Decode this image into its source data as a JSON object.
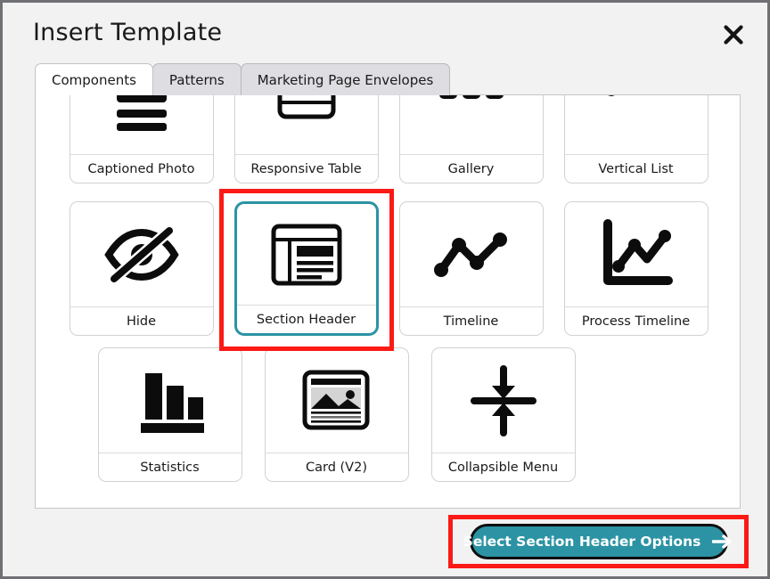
{
  "dialog": {
    "title": "Insert Template",
    "close_icon": "close-icon"
  },
  "tabs": [
    {
      "label": "Components",
      "active": true
    },
    {
      "label": "Patterns",
      "active": false
    },
    {
      "label": "Marketing Page Envelopes",
      "active": false
    }
  ],
  "templates": {
    "rows": [
      [
        {
          "label": "Captioned Photo",
          "icon": "captioned-photo-icon",
          "selected": false
        },
        {
          "label": "Responsive Table",
          "icon": "responsive-table-icon",
          "selected": false
        },
        {
          "label": "Gallery",
          "icon": "gallery-icon",
          "selected": false
        },
        {
          "label": "Vertical List",
          "icon": "vertical-list-icon",
          "selected": false
        }
      ],
      [
        {
          "label": "Hide",
          "icon": "eye-slash-icon",
          "selected": false
        },
        {
          "label": "Section Header",
          "icon": "section-header-icon",
          "selected": true
        },
        {
          "label": "Timeline",
          "icon": "timeline-icon",
          "selected": false
        },
        {
          "label": "Process Timeline",
          "icon": "process-timeline-icon",
          "selected": false
        }
      ],
      [
        {
          "label": "Statistics",
          "icon": "bar-chart-icon",
          "selected": false
        },
        {
          "label": "Card (V2)",
          "icon": "card-image-icon",
          "selected": false
        },
        {
          "label": "Collapsible Menu",
          "icon": "collapse-arrows-icon",
          "selected": false
        }
      ]
    ]
  },
  "footer": {
    "cta_label": "Select Section Header Options",
    "cta_icon": "arrow-right-icon"
  },
  "colors": {
    "accent_teal": "#2b93a4",
    "annotation_red": "#fb1a16",
    "window_bg": "#f2f2f2",
    "panel_bg": "#ffffff",
    "tab_inactive_bg": "#dedee2",
    "text": "#1a1a1a"
  }
}
